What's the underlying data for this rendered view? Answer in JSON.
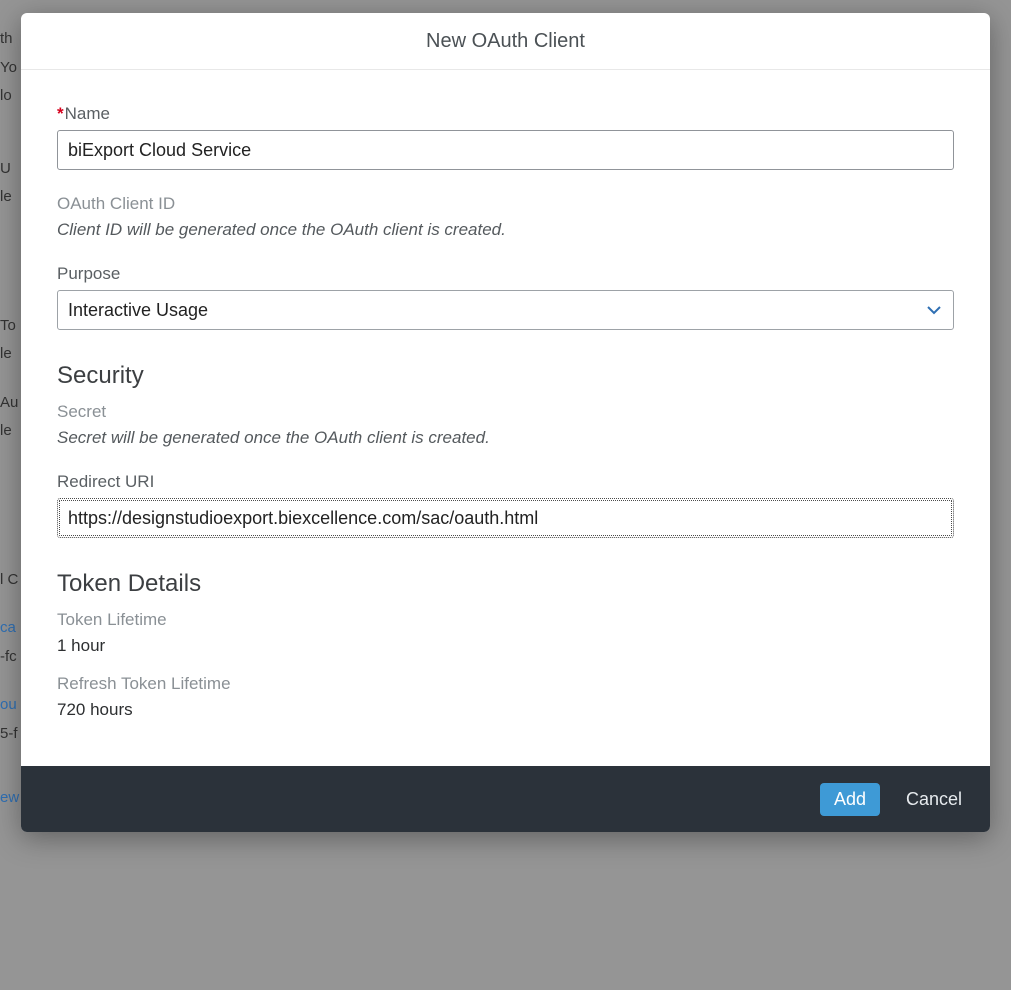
{
  "dialog": {
    "title": "New OAuth Client",
    "name": {
      "label": "Name",
      "required_mark": "*",
      "value": "biExport Cloud Service"
    },
    "client_id": {
      "label": "OAuth Client ID",
      "hint": "Client ID will be generated once the OAuth client is created."
    },
    "purpose": {
      "label": "Purpose",
      "selected": "Interactive Usage"
    },
    "security": {
      "heading": "Security",
      "secret": {
        "label": "Secret",
        "hint": "Secret will be generated once the OAuth client is created."
      },
      "redirect_uri": {
        "label": "Redirect URI",
        "value": "https://designstudioexport.biexcellence.com/sac/oauth.html"
      }
    },
    "token_details": {
      "heading": "Token Details",
      "token_lifetime": {
        "label": "Token Lifetime",
        "value": "1 hour"
      },
      "refresh_token_lifetime": {
        "label": "Refresh Token Lifetime",
        "value": "720 hours"
      }
    },
    "footer": {
      "add": "Add",
      "cancel": "Cancel"
    }
  }
}
